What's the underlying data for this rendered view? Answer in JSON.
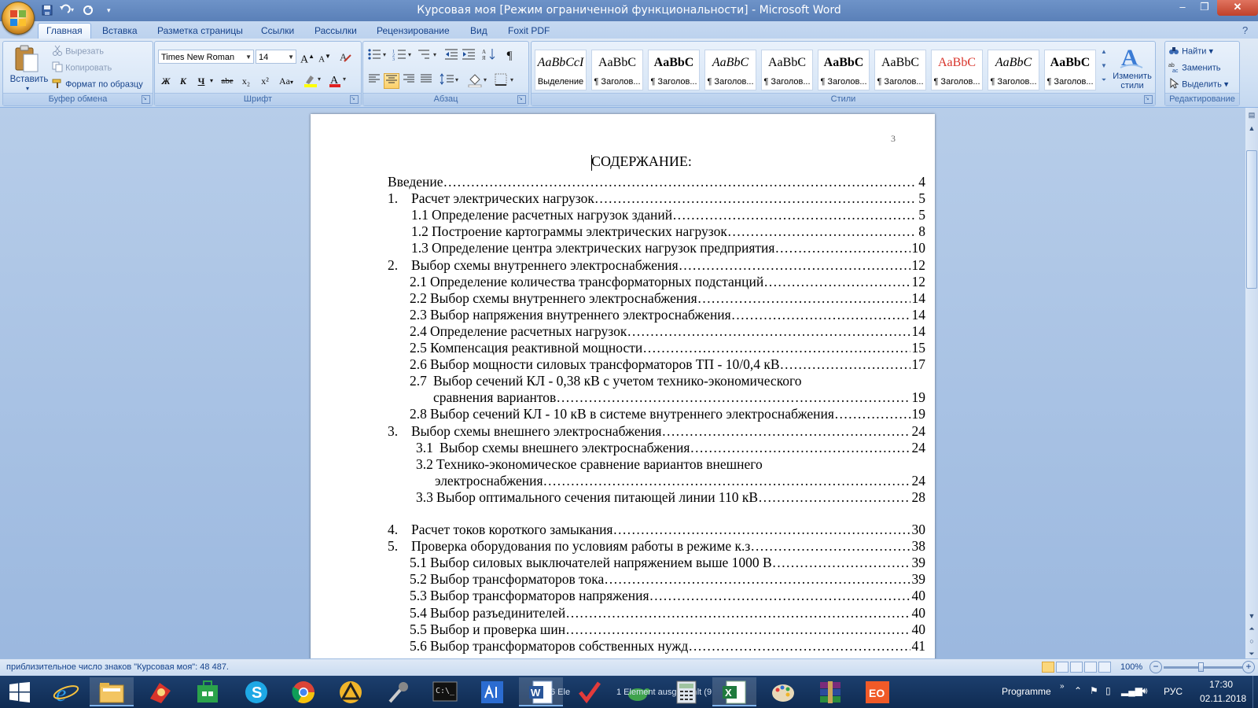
{
  "window": {
    "title": "Курсовая моя [Режим ограниченной функциональности] - Microsoft Word"
  },
  "tabs": [
    {
      "label": "Главная",
      "active": true
    },
    {
      "label": "Вставка"
    },
    {
      "label": "Разметка страницы"
    },
    {
      "label": "Ссылки"
    },
    {
      "label": "Рассылки"
    },
    {
      "label": "Рецензирование"
    },
    {
      "label": "Вид"
    },
    {
      "label": "Foxit PDF"
    }
  ],
  "ribbon": {
    "clipboard": {
      "label": "Буфер обмена",
      "paste": "Вставить",
      "cut": "Вырезать",
      "copy": "Копировать",
      "format_painter": "Формат по образцу"
    },
    "font": {
      "label": "Шрифт",
      "font_name": "Times New Roman",
      "font_size": "14",
      "bold": "Ж",
      "italic": "К",
      "underline": "Ч",
      "strike": "abe",
      "subscript": "x₂",
      "superscript": "x²",
      "change_case": "Aa",
      "grow": "A",
      "shrink": "A",
      "font_color": "A"
    },
    "paragraph": {
      "label": "Абзац"
    },
    "styles": {
      "label": "Стили",
      "items": [
        {
          "sample": "AaBbCcI",
          "name": "Выделение",
          "italic": true
        },
        {
          "sample": "AaBbC",
          "name": "¶ Заголов..."
        },
        {
          "sample": "AaBbC",
          "name": "¶ Заголов...",
          "bold": true
        },
        {
          "sample": "AaBbC",
          "name": "¶ Заголов...",
          "italic": true
        },
        {
          "sample": "AaBbC",
          "name": "¶ Заголов..."
        },
        {
          "sample": "AaBbC",
          "name": "¶ Заголов...",
          "bold": true
        },
        {
          "sample": "AaBbC",
          "name": "¶ Заголов..."
        },
        {
          "sample": "AaBbC",
          "name": "¶ Заголов...",
          "color": "#d8342b"
        },
        {
          "sample": "AaBbC",
          "name": "¶ Заголов...",
          "italic": true
        },
        {
          "sample": "AaBbC",
          "name": "¶ Заголов...",
          "bold": true
        }
      ],
      "change_styles": "Изменить стили"
    },
    "editing": {
      "label": "Редактирование",
      "find": "Найти",
      "replace": "Заменить",
      "select": "Выделить"
    }
  },
  "document": {
    "page_number": "3",
    "title": "СОДЕРЖАНИЕ:",
    "toc": [
      {
        "num": "",
        "text": "Введение",
        "page": "4"
      },
      {
        "num": "1.",
        "text": "Расчет электрических нагрузок",
        "page": "5"
      },
      {
        "num": "1.1",
        "text": "Определение расчетных нагрузок зданий",
        "page": "5"
      },
      {
        "num": "1.2",
        "text": "Построение картограммы электрических нагрузок",
        "page": "8"
      },
      {
        "num": "1.3",
        "text": "Определение центра электрических нагрузок предприятия",
        "page": "10"
      },
      {
        "num": "2.",
        "text": "Выбор схемы внутреннего электроснабжения",
        "page": "12"
      },
      {
        "num": "2.1",
        "text": "Определение количества трансформаторных подстанций",
        "page": "12"
      },
      {
        "num": "2.2",
        "text": "Выбор схемы внутреннего электроснабжения",
        "page": "14"
      },
      {
        "num": "2.3",
        "text": "Выбор напряжения внутреннего электроснабжения",
        "page": "14"
      },
      {
        "num": "2.4",
        "text": "Определение расчетных нагрузок",
        "page": "14"
      },
      {
        "num": "2.5",
        "text": "Компенсация реактивной мощности",
        "page": "15"
      },
      {
        "num": "2.6",
        "text": "Выбор мощности силовых трансформаторов ТП - 10/0,4 кВ",
        "page": "17"
      },
      {
        "num": "2.7",
        "text": "Выбор сечений КЛ - 0,38 кВ с учетом технико-экономического",
        "page": ""
      },
      {
        "num": "",
        "text": "сравнения вариантов",
        "page": "19"
      },
      {
        "num": "2.8",
        "text": "Выбор сечений КЛ - 10 кВ в системе внутреннего электроснабжения",
        "page": "19"
      },
      {
        "num": "3.",
        "text": "Выбор схемы внешнего электроснабжения",
        "page": "24"
      },
      {
        "num": "3.1",
        "text": "Выбор схемы внешнего электроснабжения",
        "page": "24"
      },
      {
        "num": "3.2",
        "text": "Технико-экономическое сравнение вариантов внешнего",
        "page": ""
      },
      {
        "num": "",
        "text": "электроснабжения",
        "page": "24"
      },
      {
        "num": "3.3",
        "text": "Выбор оптимального сечения питающей линии 110 кВ",
        "page": "28"
      },
      {
        "num": "4.",
        "text": "Расчет токов короткого замыкания",
        "page": "30"
      },
      {
        "num": "5.",
        "text": "Проверка оборудования по условиям работы в режиме к.з",
        "page": "38"
      },
      {
        "num": "5.1",
        "text": "Выбор силовых выключателей напряжением выше 1000 В",
        "page": "39"
      },
      {
        "num": "5.2",
        "text": "Выбор трансформаторов тока",
        "page": "39"
      },
      {
        "num": "5.3",
        "text": "Выбор трансформаторов напряжения",
        "page": "40"
      },
      {
        "num": "5.4",
        "text": "Выбор разъединителей",
        "page": "40"
      },
      {
        "num": "5.5",
        "text": "Выбор и проверка шин",
        "page": "40"
      },
      {
        "num": "5.6",
        "text": "Выбор трансформаторов собственных нужд",
        "page": "41"
      }
    ]
  },
  "statusbar": {
    "word_count": "приблизительное число знаков \"Курсовая моя\": 48 487.",
    "zoom": "100%"
  },
  "taskbar": {
    "labels": [
      "6 Ele",
      "1 Element ausgewählt (9"
    ],
    "programme": "Programme",
    "lang": "РУС",
    "time": "17:30",
    "date": "02.11.2018"
  }
}
